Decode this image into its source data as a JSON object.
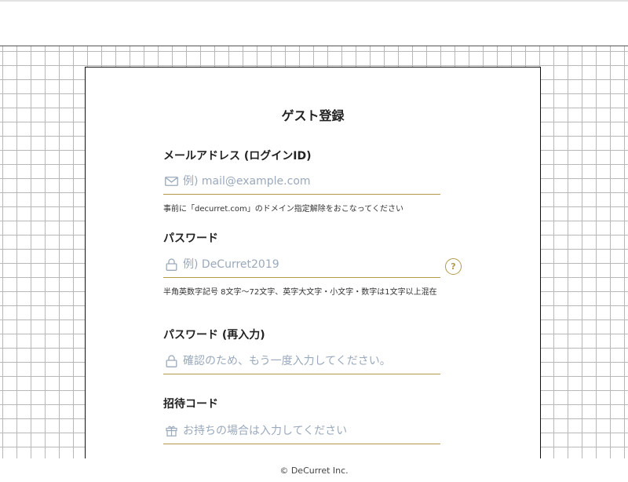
{
  "form": {
    "title": "ゲスト登録",
    "email": {
      "label": "メールアドレス (ログインID)",
      "placeholder": "例) mail@example.com",
      "hint": "事前に「decurret.com」のドメイン指定解除をおこなってください",
      "icon": "mail-icon"
    },
    "password": {
      "label": "パスワード",
      "placeholder": "例) DeCurret2019",
      "hint": "半角英数字記号 8文字〜72文字、英字大文字・小文字・数字は1文字以上混在",
      "icon": "lock-icon",
      "help": "?"
    },
    "password_confirm": {
      "label": "パスワード (再入力)",
      "placeholder": "確認のため、もう一度入力してください。",
      "icon": "lock-icon"
    },
    "invite_code": {
      "label": "招待コード",
      "placeholder": "お持ちの場合は入力してください",
      "icon": "gift-icon"
    }
  },
  "footer": {
    "copyright": "© DeCurret Inc."
  },
  "colors": {
    "accent": "#b19a4c",
    "placeholder": "#9aa9bb",
    "grid": "#b8b8b8"
  }
}
